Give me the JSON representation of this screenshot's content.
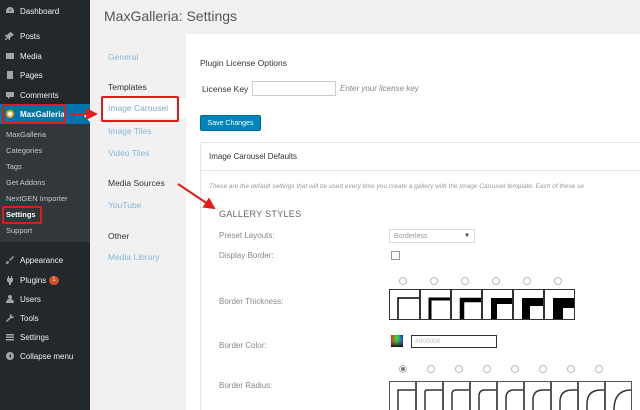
{
  "sidebar": {
    "items": [
      {
        "label": "Dashboard",
        "icon": "dashboard-icon"
      },
      {
        "label": "Posts",
        "icon": "pin-icon"
      },
      {
        "label": "Media",
        "icon": "media-icon"
      },
      {
        "label": "Pages",
        "icon": "pages-icon"
      },
      {
        "label": "Comments",
        "icon": "comments-icon"
      },
      {
        "label": "MaxGalleria",
        "icon": "maxgalleria-icon"
      },
      {
        "label": "Appearance",
        "icon": "brush-icon"
      },
      {
        "label": "Plugins",
        "icon": "plug-icon",
        "badge": "1"
      },
      {
        "label": "Users",
        "icon": "user-icon"
      },
      {
        "label": "Tools",
        "icon": "wrench-icon"
      },
      {
        "label": "Settings",
        "icon": "settings-icon"
      },
      {
        "label": "Collapse menu",
        "icon": "collapse-icon"
      }
    ],
    "submenu": [
      "MaxGalleria",
      "Categories",
      "Tags",
      "Get Addons",
      "NextGEN Importer",
      "Settings",
      "Support"
    ]
  },
  "page": {
    "title": "MaxGalleria: Settings"
  },
  "tabs": {
    "general": "General",
    "templates": "Templates",
    "image_carousel": "Image Carousel",
    "image_tiles": "Image Tiles",
    "video_tiles": "Video Tiles",
    "media_sources": "Media Sources",
    "youtube": "YouTube",
    "other": "Other",
    "media_library": "Media Library"
  },
  "license": {
    "heading": "Plugin License Options",
    "label": "License Key",
    "value": "",
    "hint": "Enter your license key"
  },
  "save_button": "Save Changes",
  "defaults": {
    "header": "Image Carousel Defaults",
    "description": "These are the default settings that will be used every time you create a gallery with the Image Carousel template. Each of these se",
    "section_title": "GALLERY STYLES",
    "preset_label": "Preset Layouts:",
    "preset_value": "Borderless",
    "display_border_label": "Display Border:",
    "border_thickness_label": "Border Thickness:",
    "border_color_label": "Border Color:",
    "border_color_value": "#000000",
    "border_radius_label": "Border Radius:"
  },
  "colors": {
    "sidebar_bg": "#23282d",
    "active_blue": "#0073aa",
    "annotation_red": "#e61919",
    "button_blue": "#0085ba"
  }
}
